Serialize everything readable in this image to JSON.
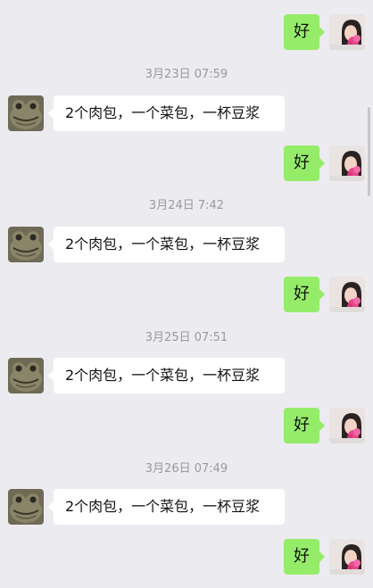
{
  "colors": {
    "background": "#ecebf0",
    "outgoing_bubble": "#95ec69",
    "incoming_bubble": "#ffffff",
    "timestamp_text": "#9a9a9a"
  },
  "messages": [
    {
      "kind": "out",
      "text": "好",
      "avatar": "woman-with-flowers-avatar"
    },
    {
      "kind": "time",
      "text": "3月23日 07:59"
    },
    {
      "kind": "in",
      "text": "2个肉包，一个菜包，一杯豆浆",
      "avatar": "frog-avatar"
    },
    {
      "kind": "out",
      "text": "好",
      "avatar": "woman-with-flowers-avatar"
    },
    {
      "kind": "time",
      "text": "3月24日 7:42"
    },
    {
      "kind": "in",
      "text": "2个肉包，一个菜包，一杯豆浆",
      "avatar": "frog-avatar"
    },
    {
      "kind": "out",
      "text": "好",
      "avatar": "woman-with-flowers-avatar"
    },
    {
      "kind": "time",
      "text": "3月25日 07:51"
    },
    {
      "kind": "in",
      "text": "2个肉包，一个菜包，一杯豆浆",
      "avatar": "frog-avatar"
    },
    {
      "kind": "out",
      "text": "好",
      "avatar": "woman-with-flowers-avatar"
    },
    {
      "kind": "time",
      "text": "3月26日 07:49"
    },
    {
      "kind": "in",
      "text": "2个肉包，一个菜包，一杯豆浆",
      "avatar": "frog-avatar"
    },
    {
      "kind": "out",
      "text": "好",
      "avatar": "woman-with-flowers-avatar"
    }
  ]
}
